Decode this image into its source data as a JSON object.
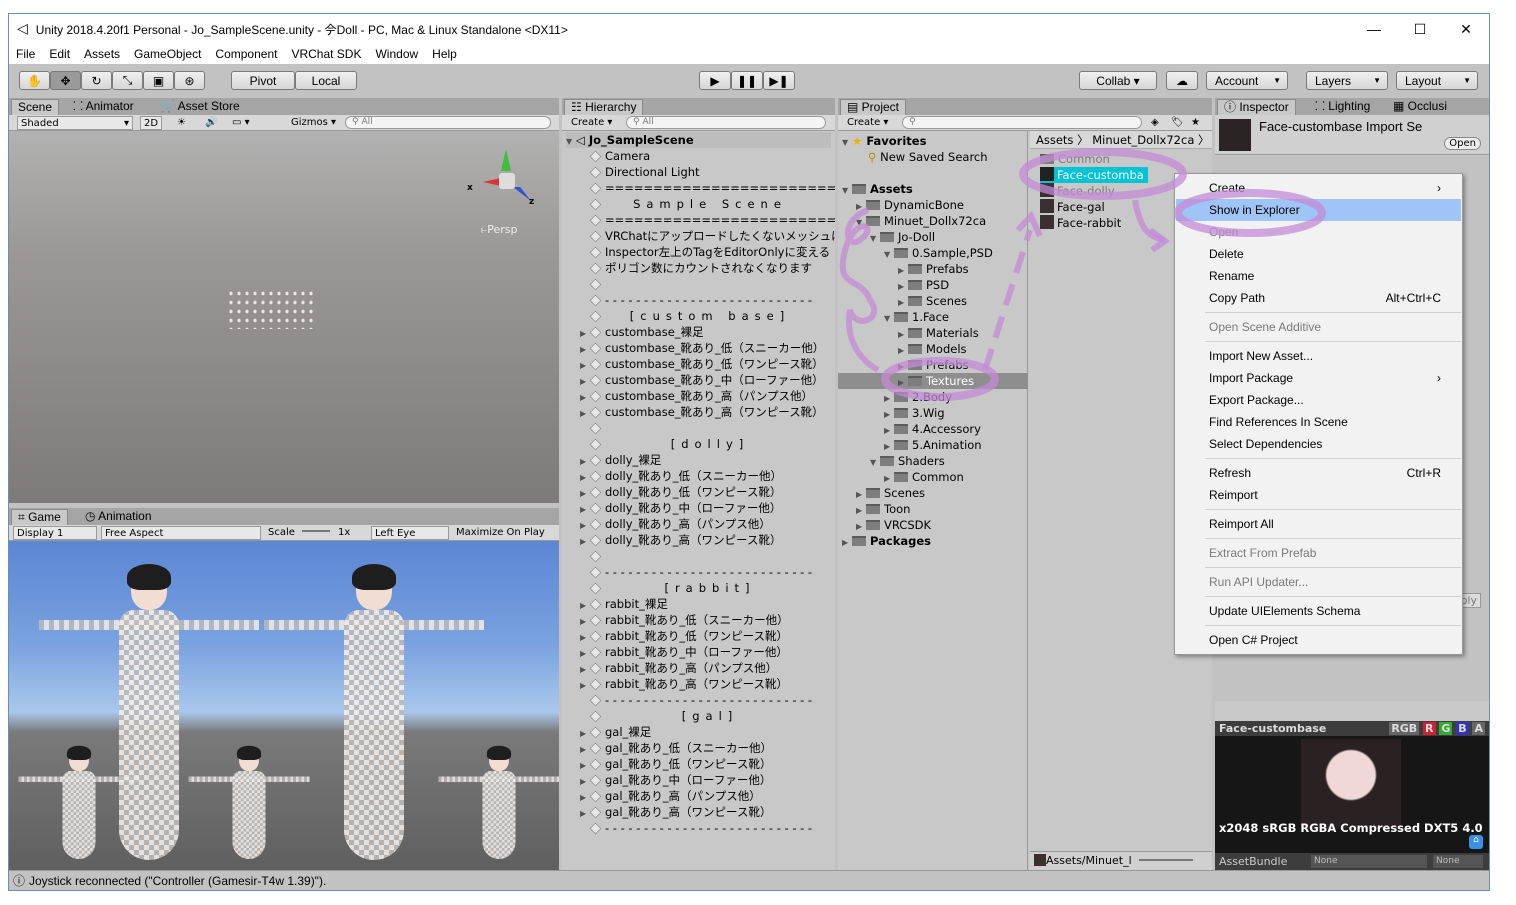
{
  "window": {
    "title": "Unity 2018.4.20f1 Personal - Jo_SampleScene.unity - 𫝆Doll - PC, Mac & Linux Standalone <DX11>",
    "min": "—",
    "max": "☐",
    "close": "✕"
  },
  "menu": [
    "File",
    "Edit",
    "Assets",
    "GameObject",
    "Component",
    "VRChat SDK",
    "Window",
    "Help"
  ],
  "toolbar": {
    "pivot": "Pivot",
    "local": "Local",
    "collab": "Collab ▾",
    "account": "Account",
    "layers": "Layers",
    "layout": "Layout"
  },
  "scene": {
    "tabs": [
      "Scene",
      "Animator",
      "Asset Store"
    ],
    "shaded": "Shaded",
    "mode2d": "2D",
    "gizmos": "Gizmos",
    "search": "All",
    "persp": "Persp"
  },
  "game": {
    "tabs": [
      "Game",
      "Animation"
    ],
    "display": "Display 1",
    "aspect": "Free Aspect",
    "scale": "Scale",
    "scale_val": "1x",
    "eye": "Left Eye",
    "maximize": "Maximize On Play"
  },
  "hierarchy": {
    "tab": "Hierarchy",
    "create": "Create",
    "search": "All",
    "scene": "Jo_SampleScene",
    "items": [
      {
        "t": "Camera",
        "a": false
      },
      {
        "t": "Directional Light",
        "a": false
      },
      {
        "t": "============================",
        "a": false
      },
      {
        "t": "Sample Scene",
        "a": false,
        "sp": true
      },
      {
        "t": "============================",
        "a": false
      },
      {
        "t": "VRChatにアップロードしたくないメッシュは",
        "a": false
      },
      {
        "t": "Inspector左上のTagをEditorOnlyに変える",
        "a": false
      },
      {
        "t": "ポリゴン数にカウントされなくなります",
        "a": false
      },
      {
        "t": "",
        "a": false
      },
      {
        "t": "- - - - - - - - - - - - - - - - - - - - - - - - - - -",
        "a": false
      },
      {
        "t": "[custom base]",
        "a": false,
        "sp": true
      },
      {
        "t": "custombase_裸足",
        "a": true
      },
      {
        "t": "custombase_靴あり_低（スニーカー他）",
        "a": true
      },
      {
        "t": "custombase_靴あり_低（ワンピース靴）",
        "a": true
      },
      {
        "t": "custombase_靴あり_中（ローファー他）",
        "a": true
      },
      {
        "t": "custombase_靴あり_高（パンプス他）",
        "a": true
      },
      {
        "t": "custombase_靴あり_高（ワンピース靴）",
        "a": true
      },
      {
        "t": "",
        "a": false
      },
      {
        "t": "[dolly]",
        "a": false,
        "sp": true
      },
      {
        "t": "dolly_裸足",
        "a": true
      },
      {
        "t": "dolly_靴あり_低（スニーカー他）",
        "a": true
      },
      {
        "t": "dolly_靴あり_低（ワンピース靴）",
        "a": true
      },
      {
        "t": "dolly_靴あり_中（ローファー他）",
        "a": true
      },
      {
        "t": "dolly_靴あり_高（パンプス他）",
        "a": true
      },
      {
        "t": "dolly_靴あり_高（ワンピース靴）",
        "a": true
      },
      {
        "t": "",
        "a": false
      },
      {
        "t": "- - - - - - - - - - - - - - - - - - - - - - - - - - -",
        "a": false
      },
      {
        "t": "[rabbit]",
        "a": false,
        "sp": true
      },
      {
        "t": "rabbit_裸足",
        "a": true
      },
      {
        "t": "rabbit_靴あり_低（スニーカー他）",
        "a": true
      },
      {
        "t": "rabbit_靴あり_低（ワンピース靴）",
        "a": true
      },
      {
        "t": "rabbit_靴あり_中（ローファー他）",
        "a": true
      },
      {
        "t": "rabbit_靴あり_高（パンプス他）",
        "a": true
      },
      {
        "t": "rabbit_靴あり_高（ワンピース靴）",
        "a": true
      },
      {
        "t": "- - - - - - - - - - - - - - - - - - - - - - - - - - -",
        "a": false
      },
      {
        "t": "[gal]",
        "a": false,
        "sp": true
      },
      {
        "t": "gal_裸足",
        "a": true
      },
      {
        "t": "gal_靴あり_低（スニーカー他）",
        "a": true
      },
      {
        "t": "gal_靴あり_低（ワンピース靴）",
        "a": true
      },
      {
        "t": "gal_靴あり_中（ローファー他）",
        "a": true
      },
      {
        "t": "gal_靴あり_高（パンプス他）",
        "a": true
      },
      {
        "t": "gal_靴あり_高（ワンピース靴）",
        "a": true
      },
      {
        "t": "- - - - - - - - - - - - - - - - - - - - - - - - - - -",
        "a": false
      }
    ]
  },
  "project": {
    "tab": "Project",
    "create": "Create",
    "favorites": "Favorites",
    "saved_search": "New Saved Search",
    "tree": [
      {
        "t": "Assets",
        "d": 0,
        "b": true,
        "open": true
      },
      {
        "t": "DynamicBone",
        "d": 1
      },
      {
        "t": "Minuet_Dollx72ca",
        "d": 1,
        "open": true
      },
      {
        "t": "Jo-Doll",
        "d": 2,
        "open": true
      },
      {
        "t": "0.Sample,PSD",
        "d": 3,
        "open": true
      },
      {
        "t": "Prefabs",
        "d": 4
      },
      {
        "t": "PSD",
        "d": 4
      },
      {
        "t": "Scenes",
        "d": 4
      },
      {
        "t": "1.Face",
        "d": 3,
        "open": true
      },
      {
        "t": "Materials",
        "d": 4
      },
      {
        "t": "Models",
        "d": 4
      },
      {
        "t": "Prefabs",
        "d": 4
      },
      {
        "t": "Textures",
        "d": 4,
        "sel": true
      },
      {
        "t": "2.Body",
        "d": 3
      },
      {
        "t": "3.Wig",
        "d": 3
      },
      {
        "t": "4.Accessory",
        "d": 3
      },
      {
        "t": "5.Animation",
        "d": 3
      },
      {
        "t": "Shaders",
        "d": 2,
        "open": true
      },
      {
        "t": "Common",
        "d": 3
      },
      {
        "t": "Scenes",
        "d": 1
      },
      {
        "t": "Toon",
        "d": 1
      },
      {
        "t": "VRCSDK",
        "d": 1
      },
      {
        "t": "Packages",
        "d": 0,
        "b": true
      }
    ],
    "breadcrumb": [
      "Assets",
      "Minuet_Dollx72ca"
    ],
    "files": [
      "Common",
      "Face-customba",
      "Face-dolly",
      "Face-gal",
      "Face-rabbit"
    ],
    "bottom_path": "Assets/Minuet_l"
  },
  "inspector": {
    "tabs": [
      "Inspector",
      "Lighting",
      "Occlusi"
    ],
    "title": "Face-custombase Import Se",
    "open": "Open",
    "preview_name": "Face-custombase",
    "channels": [
      "RGB",
      "R",
      "G",
      "B",
      "A"
    ],
    "info": "x2048 sRGB  RGBA Compressed DXT5  4.0",
    "assetbundle": "AssetBundle",
    "none1": "None",
    "none2": "None",
    "apply": "ply"
  },
  "context_menu": [
    {
      "l": "Create",
      "sub": true,
      "dis": false
    },
    {
      "l": "Show in Explorer",
      "hl": true
    },
    {
      "l": "Open",
      "dis": true
    },
    {
      "l": "Delete"
    },
    {
      "l": "Rename"
    },
    {
      "l": "Copy Path",
      "sc": "Alt+Ctrl+C"
    },
    {
      "sep": true
    },
    {
      "l": "Open Scene Additive",
      "dis": true
    },
    {
      "sep": true
    },
    {
      "l": "Import New Asset..."
    },
    {
      "l": "Import Package",
      "sub": true
    },
    {
      "l": "Export Package..."
    },
    {
      "l": "Find References In Scene"
    },
    {
      "l": "Select Dependencies"
    },
    {
      "sep": true
    },
    {
      "l": "Refresh",
      "sc": "Ctrl+R"
    },
    {
      "l": "Reimport"
    },
    {
      "sep": true
    },
    {
      "l": "Reimport All"
    },
    {
      "sep": true
    },
    {
      "l": "Extract From Prefab",
      "dis": true
    },
    {
      "sep": true
    },
    {
      "l": "Run API Updater...",
      "dis": true
    },
    {
      "sep": true
    },
    {
      "l": "Update UIElements Schema"
    },
    {
      "sep": true
    },
    {
      "l": "Open C# Project"
    }
  ],
  "status": "Joystick reconnected (\"Controller (Gamesir-T4w 1.39)\").",
  "colors": {
    "selection": "#3e7de7",
    "highlight": "#9fc5f8",
    "annotation": "#c48ad6",
    "cyan": "#00c4d6"
  }
}
